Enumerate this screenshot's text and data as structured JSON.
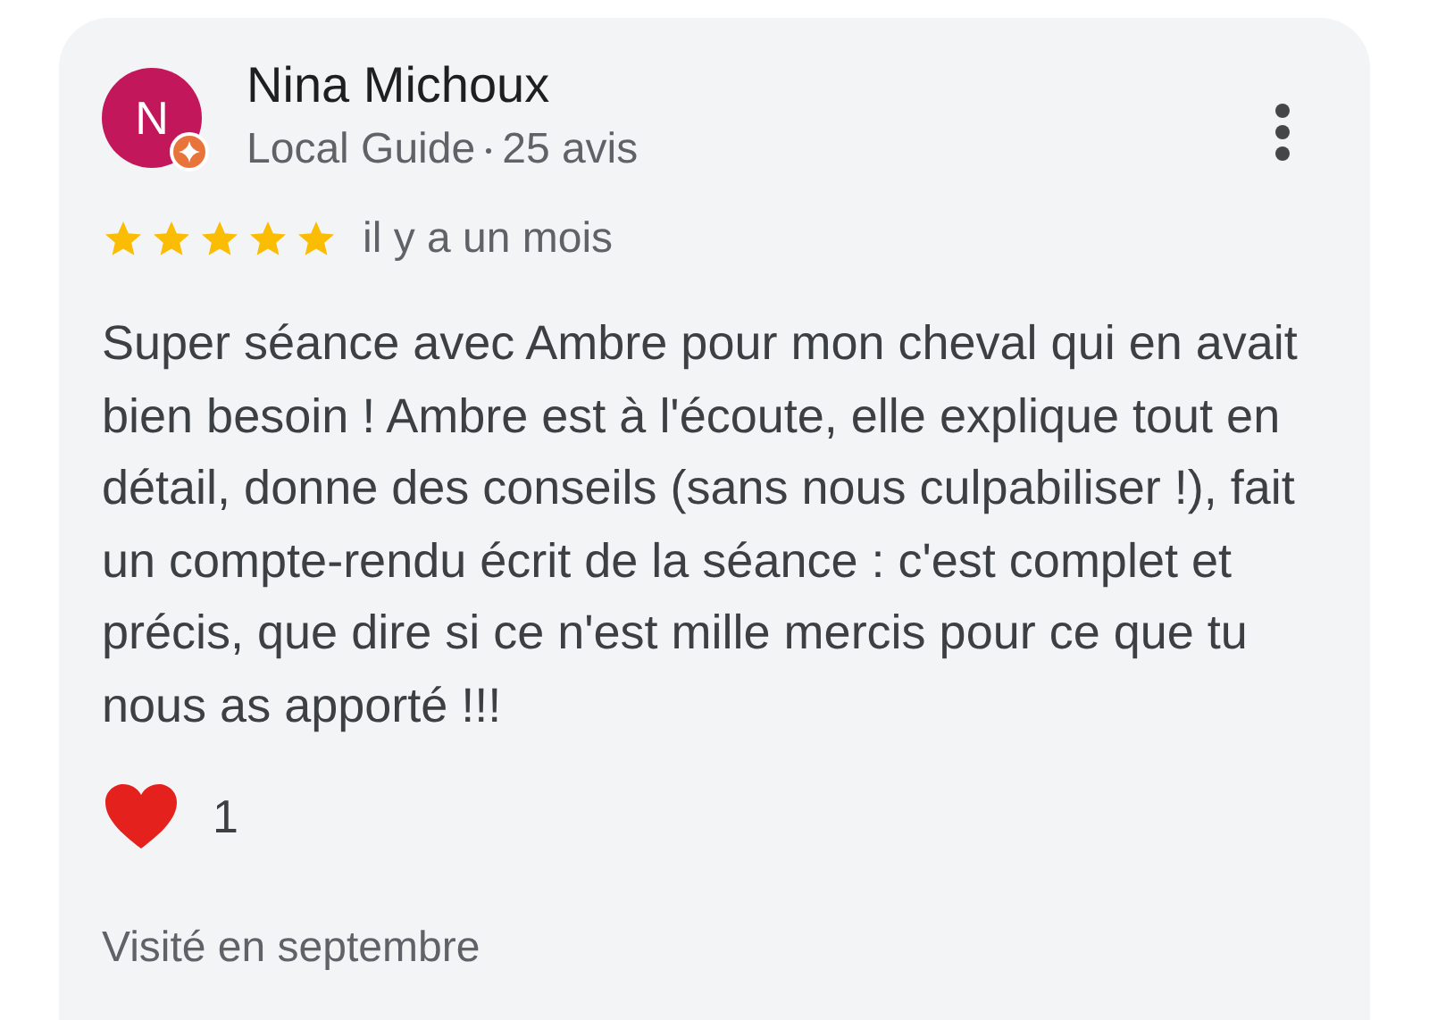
{
  "review": {
    "author": {
      "initial": "N",
      "name": "Nina Michoux",
      "badge": "Local Guide",
      "reviews": "25 avis",
      "local_guide": true
    },
    "stars": 5,
    "time": "il y a un mois",
    "text": "Super séance avec Ambre pour mon cheval qui en avait bien besoin ! Ambre est à l'écoute, elle explique tout en détail, donne des conseils (sans nous culpabiliser !), fait un compte-rendu écrit de la séance : c'est complet et précis, que dire si ce n'est mille mercis pour ce que tu nous as apporté !!!",
    "reaction": {
      "count": "1"
    },
    "visit": "Visité en septembre"
  }
}
